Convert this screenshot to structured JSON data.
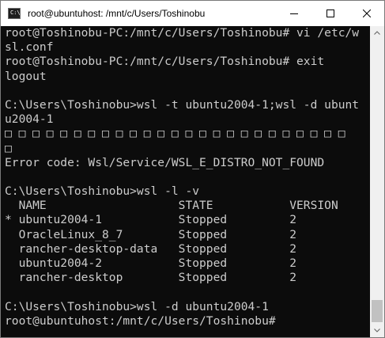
{
  "window": {
    "title": "root@ubuntuhost: /mnt/c/Users/Toshinobu",
    "icon": "terminal-icon",
    "icon_glyph": "C:\\",
    "controls": [
      "minimize-icon",
      "maximize-icon",
      "close-icon"
    ]
  },
  "terminal": {
    "lines": [
      "root@Toshinobu-PC:/mnt/c/Users/Toshinobu# vi /etc/w",
      "sl.conf",
      "root@Toshinobu-PC:/mnt/c/Users/Toshinobu# exit",
      "logout",
      "",
      "C:\\Users\\Toshinobu>wsl -t ubuntu2004-1;wsl -d ubunt",
      "u2004-1",
      "□ □ □ □ □ □ □ □ □ □ □ □ □ □ □ □ □ □ □ □ □ □ □ □ □",
      "□",
      "Error code: Wsl/Service/WSL_E_DISTRO_NOT_FOUND",
      "",
      "C:\\Users\\Toshinobu>wsl -l -v",
      "  NAME                   STATE           VERSION",
      "* ubuntu2004-1           Stopped         2",
      "  OracleLinux_8_7        Stopped         2",
      "  rancher-desktop-data   Stopped         2",
      "  ubuntu2004-2           Stopped         2",
      "  rancher-desktop        Stopped         2",
      "",
      "C:\\Users\\Toshinobu>wsl -d ubuntu2004-1",
      "root@ubuntuhost:/mnt/c/Users/Toshinobu#"
    ]
  },
  "colors": {
    "terminal_bg": "#0c0c0c",
    "terminal_fg": "#cccccc",
    "titlebar_bg": "#ffffff",
    "scrollbar_bg": "#f0f0f0",
    "scroll_thumb": "#c1c1c1"
  }
}
